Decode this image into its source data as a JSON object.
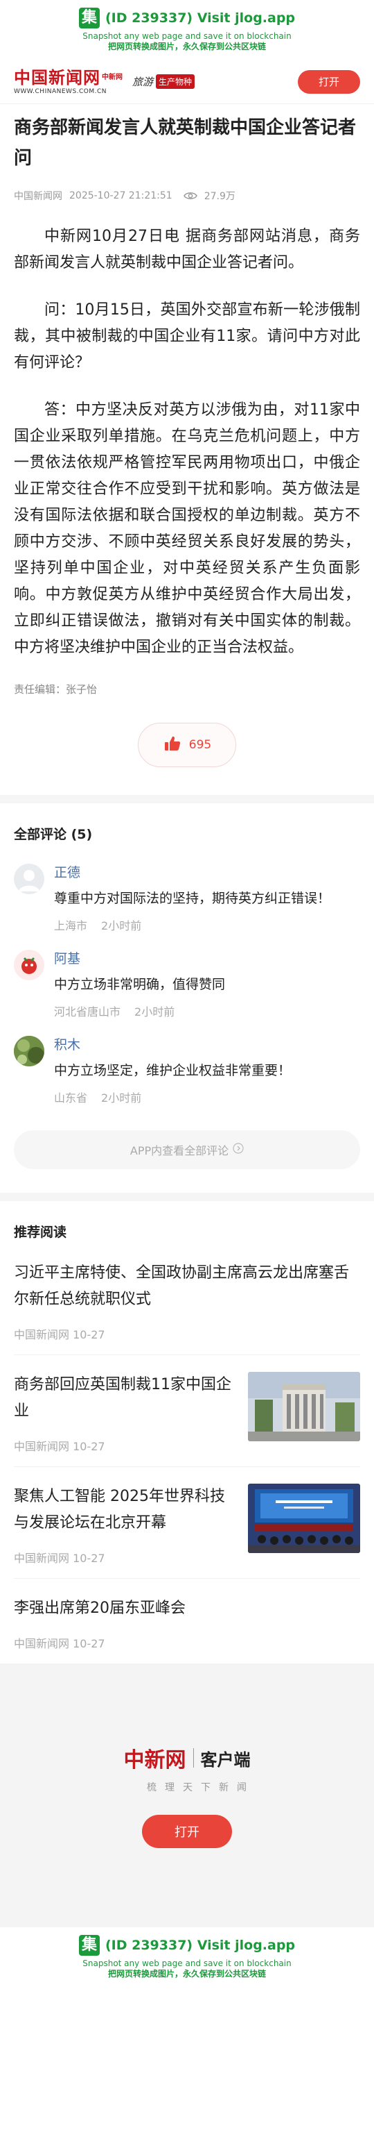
{
  "jlog": {
    "logo_glyph": "集",
    "title": "(ID 239337) Visit jlog.app",
    "sub_en": "Snapshot any web page and save it on blockchain",
    "sub_cn": "把网页转换成图片，永久保存到公共区块链"
  },
  "header": {
    "logo_cn": "中国新闻网",
    "logo_tag": "中新网",
    "logo_url": "WWW.CHINANEWS.COM.CN",
    "slogan_a": "旅游",
    "slogan_b": "生产物种",
    "open_label": "打开"
  },
  "article": {
    "title": "商务部新闻发言人就英制裁中国企业答记者问",
    "source": "中国新闻网",
    "datetime": "2025-10-27 21:21:51",
    "views": "27.9万",
    "paragraphs": [
      "中新网10月27日电  据商务部网站消息，商务部新闻发言人就英制裁中国企业答记者问。",
      "问：10月15日，英国外交部宣布新一轮涉俄制裁，其中被制裁的中国企业有11家。请问中方对此有何评论？",
      "答：中方坚决反对英方以涉俄为由，对11家中国企业采取列单措施。在乌克兰危机问题上，中方一贯依法依规严格管控军民两用物项出口，中俄企业正常交往合作不应受到干扰和影响。英方做法是没有国际法依据和联合国授权的单边制裁。英方不顾中方交涉、不顾中英经贸关系良好发展的势头，坚持列单中国企业，对中英经贸关系产生负面影响。中方敦促英方从维护中英经贸合作大局出发，立即纠正错误做法，撤销对有关中国实体的制裁。中方将坚决维护中国企业的正当合法权益。"
    ],
    "editor": "责任编辑：张子怡",
    "likes": "695"
  },
  "comments": {
    "title": "全部评论 (5)",
    "items": [
      {
        "name": "正德",
        "text": "尊重中方对国际法的坚持，期待英方纠正错误！",
        "location": "上海市",
        "time": "2小时前"
      },
      {
        "name": "阿基",
        "text": "中方立场非常明确，值得赞同",
        "location": "河北省唐山市",
        "time": "2小时前"
      },
      {
        "name": "积木",
        "text": "中方立场坚定，维护企业权益非常重要！",
        "location": "山东省",
        "time": "2小时前"
      }
    ],
    "more_label": "APP内查看全部评论"
  },
  "recommended": {
    "title": "推荐阅读",
    "items": [
      {
        "title": "习近平主席特使、全国政协副主席高云龙出席塞舌尔新任总统就职仪式",
        "source": "中国新闻网 10-27"
      },
      {
        "title": "商务部回应英国制裁11家中国企业",
        "source": "中国新闻网 10-27"
      },
      {
        "title": "聚焦人工智能 2025年世界科技与发展论坛在北京开幕",
        "source": "中国新闻网 10-27"
      },
      {
        "title": "李强出席第20届东亚峰会",
        "source": "中国新闻网 10-27"
      }
    ]
  },
  "footer": {
    "logo_cn": "中新网",
    "client_label": "客户端",
    "slogan": "梳理天下新闻",
    "open_label": "打开"
  },
  "colors": {
    "accent": "#e8443a",
    "brand_red": "#c8161d",
    "jlog_green": "#1a9a3a",
    "username_blue": "#4a6fa5"
  }
}
